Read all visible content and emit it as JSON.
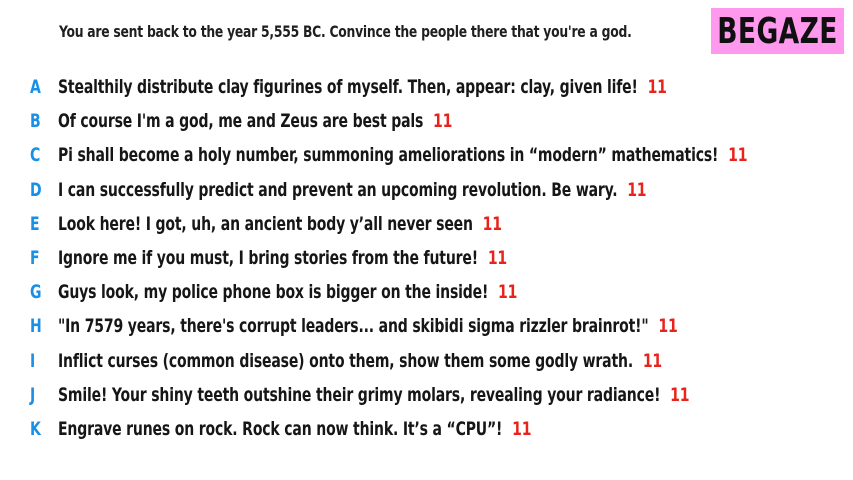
{
  "prompt": "You are sent back to the year 5,555 BC. Convince the people there that you're a god.",
  "logo": "BEGAZE",
  "colors": {
    "letter": "#1a8fe6",
    "count": "#e8231c",
    "logo_bg": "#ff99ee"
  },
  "options": [
    {
      "letter": "A",
      "text": "Stealthily distribute clay figurines of myself. Then, appear: clay, given life!",
      "count": "11"
    },
    {
      "letter": "B",
      "text": "Of course I'm a god, me and Zeus are best pals",
      "count": "11"
    },
    {
      "letter": "C",
      "text": "Pi shall become a holy number, summoning ameliorations in “modern” mathematics!",
      "count": "11"
    },
    {
      "letter": "D",
      "text": "I can successfully predict and prevent an upcoming revolution. Be wary.",
      "count": "11"
    },
    {
      "letter": "E",
      "text": "Look here! I got, uh, an ancient body y’all never seen",
      "count": "11"
    },
    {
      "letter": "F",
      "text": "Ignore me if you must, I bring stories from the future!",
      "count": "11"
    },
    {
      "letter": "G",
      "text": "Guys look, my police phone box is bigger on the inside!",
      "count": "11"
    },
    {
      "letter": "H",
      "text": "\"In 7579 years, there's corrupt leaders... and skibidi sigma rizzler brainrot!\"",
      "count": "11"
    },
    {
      "letter": "I",
      "text": "Inflict curses (common disease) onto them, show them some godly wrath.",
      "count": "11"
    },
    {
      "letter": "J",
      "text": "Smile! Your shiny teeth outshine their grimy molars, revealing your radiance!",
      "count": "11"
    },
    {
      "letter": "K",
      "text": "Engrave runes on rock. Rock can now think. It’s a “CPU”!",
      "count": "11"
    }
  ]
}
